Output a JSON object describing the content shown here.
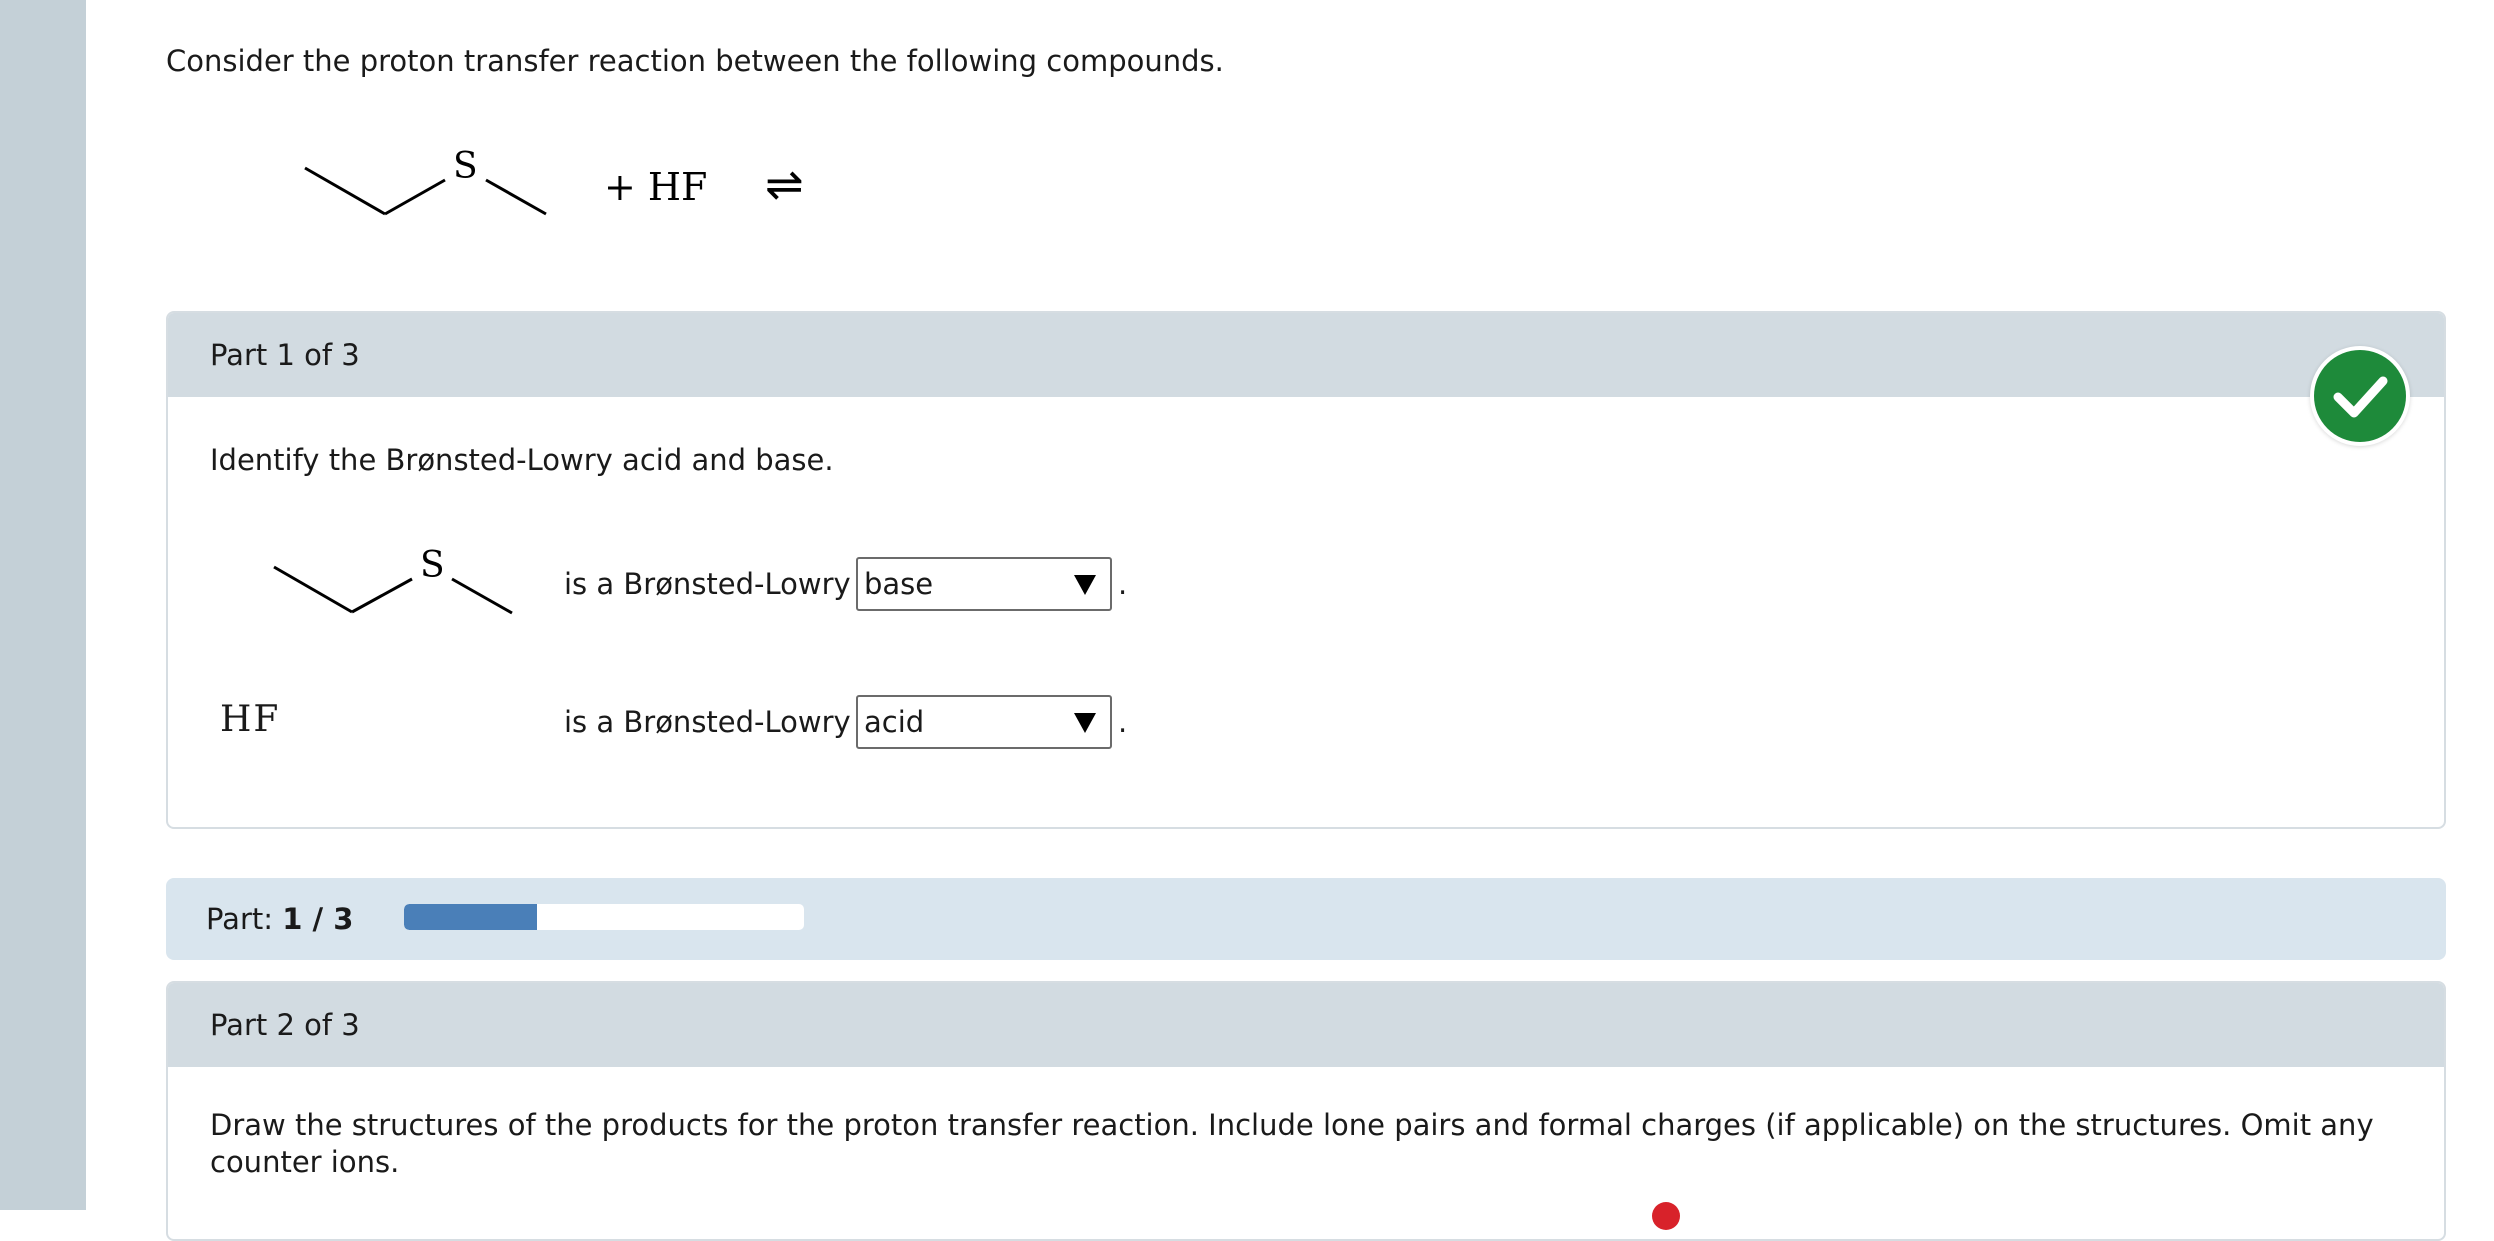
{
  "question": {
    "intro": "Consider the proton transfer reaction between the following compounds.",
    "reaction": {
      "sulfur_label": "S",
      "plus_reagent": "+ HF",
      "equilibrium_symbol": "⇌"
    }
  },
  "part1": {
    "header": "Part 1 of 3",
    "instruction": "Identify the Brønsted-Lowry acid and base.",
    "rows": [
      {
        "molecule_label": "S",
        "text": "is a Brønsted-Lowry",
        "selected": "base",
        "trail": "."
      },
      {
        "molecule_label": "HF",
        "text": "is a Brønsted-Lowry",
        "selected": "acid",
        "trail": "."
      }
    ],
    "status": "correct"
  },
  "progress": {
    "label": "Part:",
    "value": "1 / 3",
    "fraction": 0.3333
  },
  "part2": {
    "header": "Part 2 of 3",
    "instruction": "Draw the structures of the products for the proton transfer reaction. Include lone pairs and formal charges (if applicable) on the structures. Omit any counter ions."
  },
  "icons": {
    "correct": "checkmark-icon",
    "dropdown": "triangle-down-icon",
    "error_indicator": "red-dot-icon"
  },
  "colors": {
    "correct_green": "#1e8a3a",
    "progress_fill": "#4a7fb8",
    "header_bg": "#d2dbe1",
    "progress_band_bg": "#d9e5ee"
  }
}
